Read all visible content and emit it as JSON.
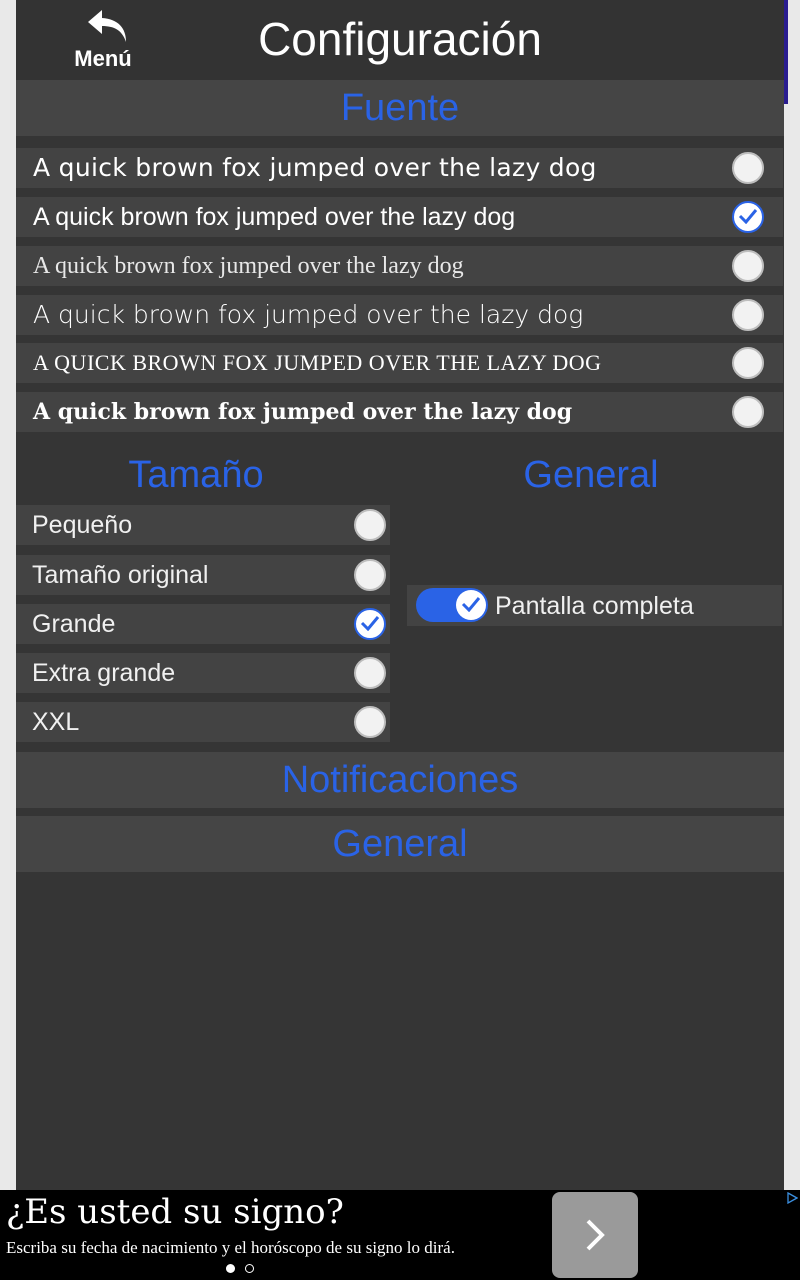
{
  "header": {
    "back_label": "Menú",
    "title": "Configuración"
  },
  "font_section": {
    "title": "Fuente",
    "options": [
      {
        "label": "A quick brown fox jumped over the lazy dog",
        "selected": false
      },
      {
        "label": "A quick brown fox jumped over the lazy dog",
        "selected": true
      },
      {
        "label": "A quick brown fox jumped over the lazy dog",
        "selected": false
      },
      {
        "label": "A quick brown fox jumped over the lazy dog",
        "selected": false
      },
      {
        "label": "A QUICK BROWN FOX JUMPED OVER THE LAZY DOG",
        "selected": false
      },
      {
        "label": "A quick brown fox jumped over the lazy dog",
        "selected": false
      }
    ]
  },
  "size_section": {
    "title": "Tamaño",
    "options": [
      {
        "label": "Pequeño",
        "selected": false
      },
      {
        "label": "Tamaño original",
        "selected": false
      },
      {
        "label": "Grande",
        "selected": true
      },
      {
        "label": "Extra grande",
        "selected": false
      },
      {
        "label": "XXL",
        "selected": false
      }
    ]
  },
  "general_section": {
    "title": "General",
    "fullscreen_label": "Pantalla completa",
    "fullscreen_on": true
  },
  "notifications_bar": {
    "title": "Notificaciones"
  },
  "general_bar": {
    "title": "General"
  },
  "ad": {
    "title": "¿Es usted su signo?",
    "description": "Escriba su fecha de nacimiento y el horóscopo de su signo lo dirá."
  },
  "colors": {
    "accent": "#2a63e6",
    "panel": "#353535",
    "row": "#434343"
  }
}
